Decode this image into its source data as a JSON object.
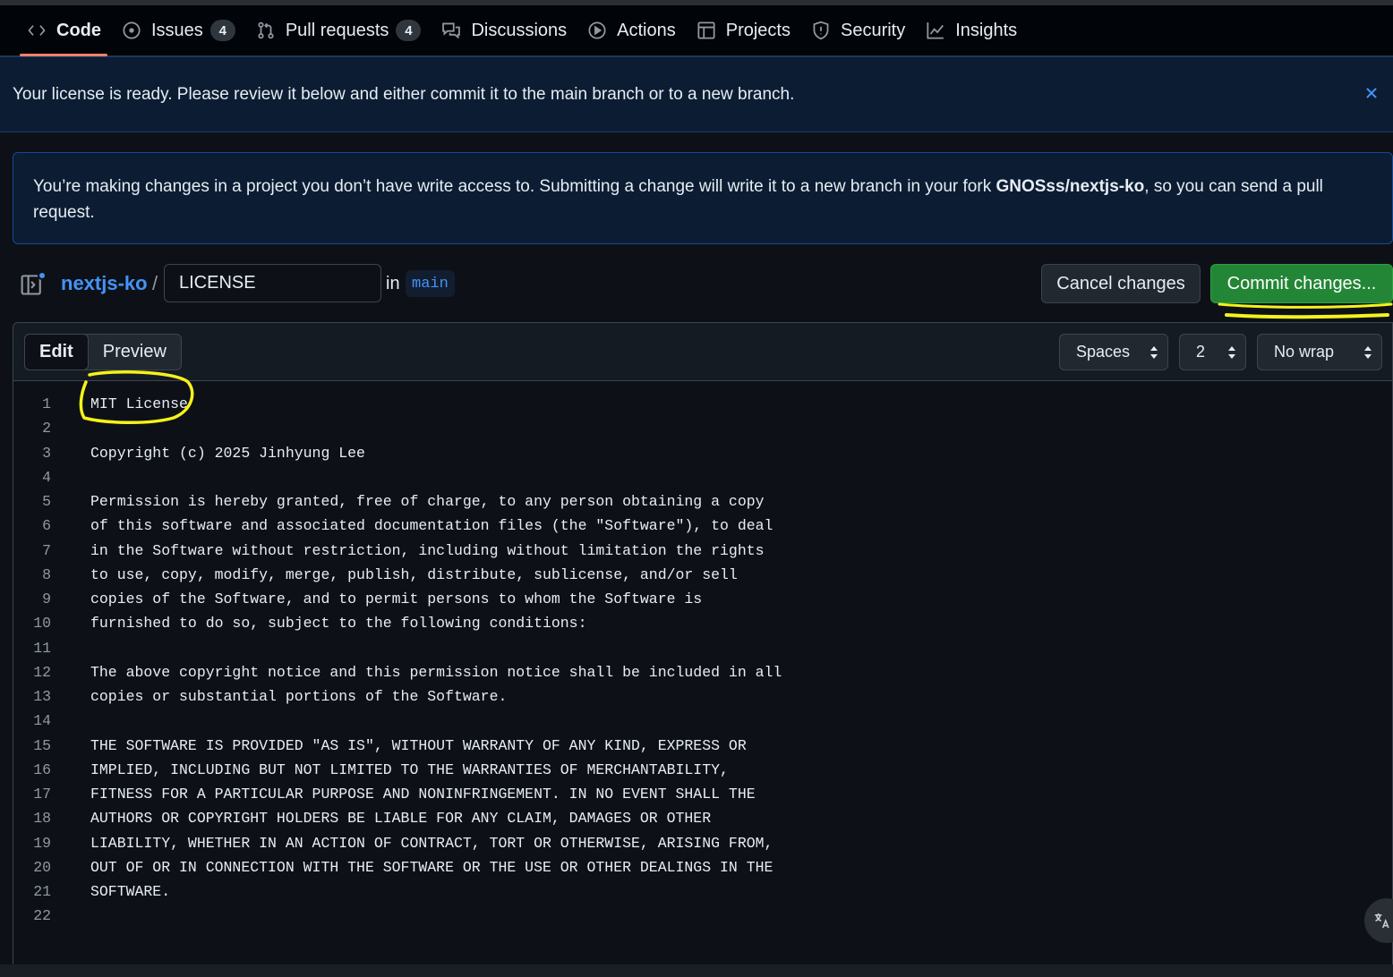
{
  "nav": {
    "items": [
      {
        "label": "Code",
        "icon": "code-icon",
        "count": null,
        "active": true
      },
      {
        "label": "Issues",
        "icon": "issue-opened-icon",
        "count": "4",
        "active": false
      },
      {
        "label": "Pull requests",
        "icon": "git-pull-request-icon",
        "count": "4",
        "active": false
      },
      {
        "label": "Discussions",
        "icon": "comment-discussion-icon",
        "count": null,
        "active": false
      },
      {
        "label": "Actions",
        "icon": "play-icon",
        "count": null,
        "active": false
      },
      {
        "label": "Projects",
        "icon": "table-icon",
        "count": null,
        "active": false
      },
      {
        "label": "Security",
        "icon": "shield-icon",
        "count": null,
        "active": false
      },
      {
        "label": "Insights",
        "icon": "graph-icon",
        "count": null,
        "active": false
      }
    ]
  },
  "flash": {
    "message": "Your license is ready. Please review it below and either commit it to the main branch or to a new branch."
  },
  "notice": {
    "text_before": "You’re making changes in a project you don’t have write access to. Submitting a change will write it to a new branch in your fork ",
    "fork_name": "GNOSss/nextjs-ko",
    "text_after": ", so you can send a pull request."
  },
  "file_header": {
    "repo": "nextjs-ko",
    "separator": "/",
    "filename": "LICENSE",
    "in_label": "in",
    "branch": "main",
    "cancel_label": "Cancel changes",
    "commit_label": "Commit changes..."
  },
  "toolbar": {
    "edit_label": "Edit",
    "preview_label": "Preview",
    "indent_mode": "Spaces",
    "indent_size": "2",
    "wrap_mode": "No wrap"
  },
  "code_lines": [
    "MIT License",
    "",
    "Copyright (c) 2025 Jinhyung Lee",
    "",
    "Permission is hereby granted, free of charge, to any person obtaining a copy",
    "of this software and associated documentation files (the \"Software\"), to deal",
    "in the Software without restriction, including without limitation the rights",
    "to use, copy, modify, merge, publish, distribute, sublicense, and/or sell",
    "copies of the Software, and to permit persons to whom the Software is",
    "furnished to do so, subject to the following conditions:",
    "",
    "The above copyright notice and this permission notice shall be included in all",
    "copies or substantial portions of the Software.",
    "",
    "THE SOFTWARE IS PROVIDED \"AS IS\", WITHOUT WARRANTY OF ANY KIND, EXPRESS OR",
    "IMPLIED, INCLUDING BUT NOT LIMITED TO THE WARRANTIES OF MERCHANTABILITY,",
    "FITNESS FOR A PARTICULAR PURPOSE AND NONINFRINGEMENT. IN NO EVENT SHALL THE",
    "AUTHORS OR COPYRIGHT HOLDERS BE LIABLE FOR ANY CLAIM, DAMAGES OR OTHER",
    "LIABILITY, WHETHER IN AN ACTION OF CONTRACT, TORT OR OTHERWISE, ARISING FROM,",
    "OUT OF OR IN CONNECTION WITH THE SOFTWARE OR THE USE OR OTHER DEALINGS IN THE",
    "SOFTWARE.",
    ""
  ],
  "colors": {
    "accent": "#4493f8",
    "commit_green": "#238636",
    "annotation_yellow": "#f5f21a",
    "active_tab_underline": "#f78166"
  }
}
